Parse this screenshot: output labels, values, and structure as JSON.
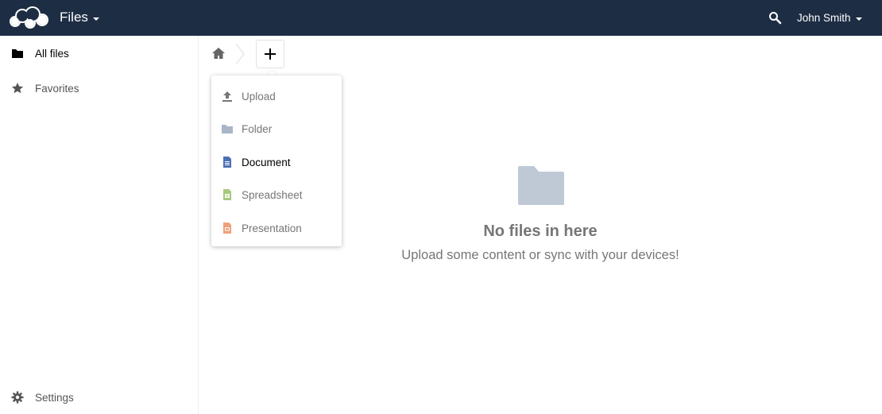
{
  "header": {
    "app_title": "Files",
    "user_name": "John Smith",
    "bg_color": "#1d2d44"
  },
  "sidebar": {
    "items": [
      {
        "label": "All files",
        "icon": "folder-icon",
        "active": true
      },
      {
        "label": "Favorites",
        "icon": "star-icon",
        "active": false
      }
    ],
    "settings_label": "Settings"
  },
  "new_menu": {
    "items": [
      {
        "label": "Upload",
        "icon": "upload-icon"
      },
      {
        "label": "Folder",
        "icon": "folder-icon"
      },
      {
        "label": "Document",
        "icon": "document-icon",
        "active": true
      },
      {
        "label": "Spreadsheet",
        "icon": "spreadsheet-icon"
      },
      {
        "label": "Presentation",
        "icon": "presentation-icon"
      }
    ],
    "colors": {
      "folder": "#a8b6c8",
      "document": "#4a6fb5",
      "spreadsheet": "#a8c97e",
      "presentation": "#f0a07a"
    }
  },
  "empty": {
    "title": "No files in here",
    "subtitle": "Upload some content or sync with your devices!"
  }
}
